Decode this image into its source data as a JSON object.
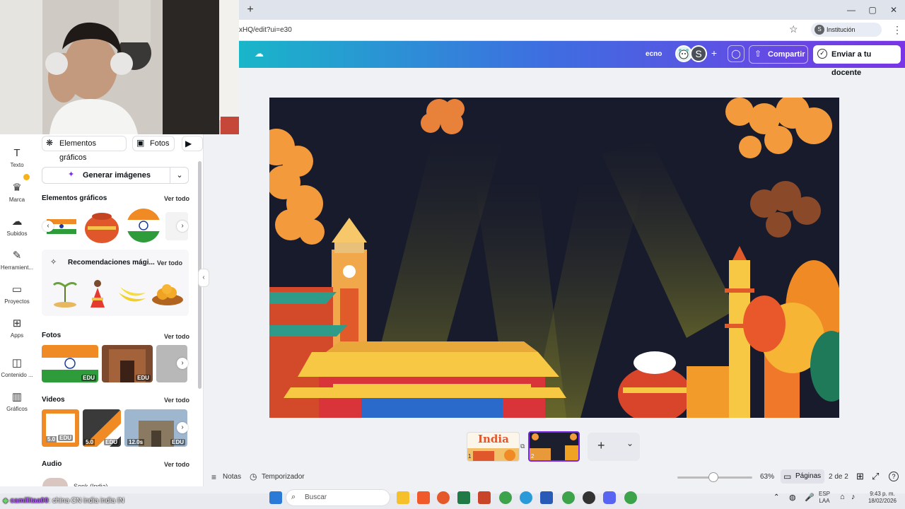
{
  "browser": {
    "new_tab": "+",
    "url": "xHQ/edit?ui=e30",
    "profile_initial": "S",
    "profile_label": "Institución educativa",
    "window_controls": [
      "—",
      "▢",
      "✕"
    ]
  },
  "header": {
    "doc_name": "ecno",
    "collaborator_initial": "S",
    "share_label": "Compartir",
    "send_label": "Enviar a tu docente",
    "gradient_colors": [
      "#19b6c9",
      "#3d6fe0",
      "#7a35e6"
    ]
  },
  "rail": {
    "items": [
      {
        "label": "Texto",
        "icon": "T"
      },
      {
        "label": "Marca",
        "icon": "♛"
      },
      {
        "label": "Subidos",
        "icon": "☁"
      },
      {
        "label": "Herramient...",
        "icon": "✎"
      },
      {
        "label": "Proyectos",
        "icon": "▭"
      },
      {
        "label": "Apps",
        "icon": "⊞"
      },
      {
        "label": "Contenido ...",
        "icon": "◫"
      },
      {
        "label": "Gráficos",
        "icon": "▥"
      }
    ]
  },
  "panel": {
    "chips": [
      "Elementos gráficos",
      "Fotos"
    ],
    "generate_label": "Generar imágenes",
    "graphics_title": "Elementos gráficos",
    "recommend_title": "Recomendaciones mági...",
    "photos_title": "Fotos",
    "videos_title": "Videos",
    "audio_title": "Audio",
    "audio_item": "Sonk (India)",
    "see_all": "Ver todo",
    "edu_badge": "EDU",
    "video_durations": [
      "5.0",
      "5.0",
      "12.0s"
    ]
  },
  "pages": {
    "page1_title": "India",
    "page1_num": "1",
    "page2_num": "2",
    "add": "+",
    "dropdown": "⌄"
  },
  "bottom": {
    "notes_label": "Notas",
    "timer_label": "Temporizador",
    "zoom": "63%",
    "zoom_level": 0.42,
    "pages_label": "Páginas",
    "page_count": "2 de 2",
    "help": "?"
  },
  "stream": {
    "user": "camilitaa00",
    "message": ": china CN india india IN"
  },
  "taskbar": {
    "search_placeholder": "Buscar",
    "lang": "ESP",
    "lang2": "LAA",
    "time": "9:43 p. m.",
    "date": "18/02/2026"
  }
}
